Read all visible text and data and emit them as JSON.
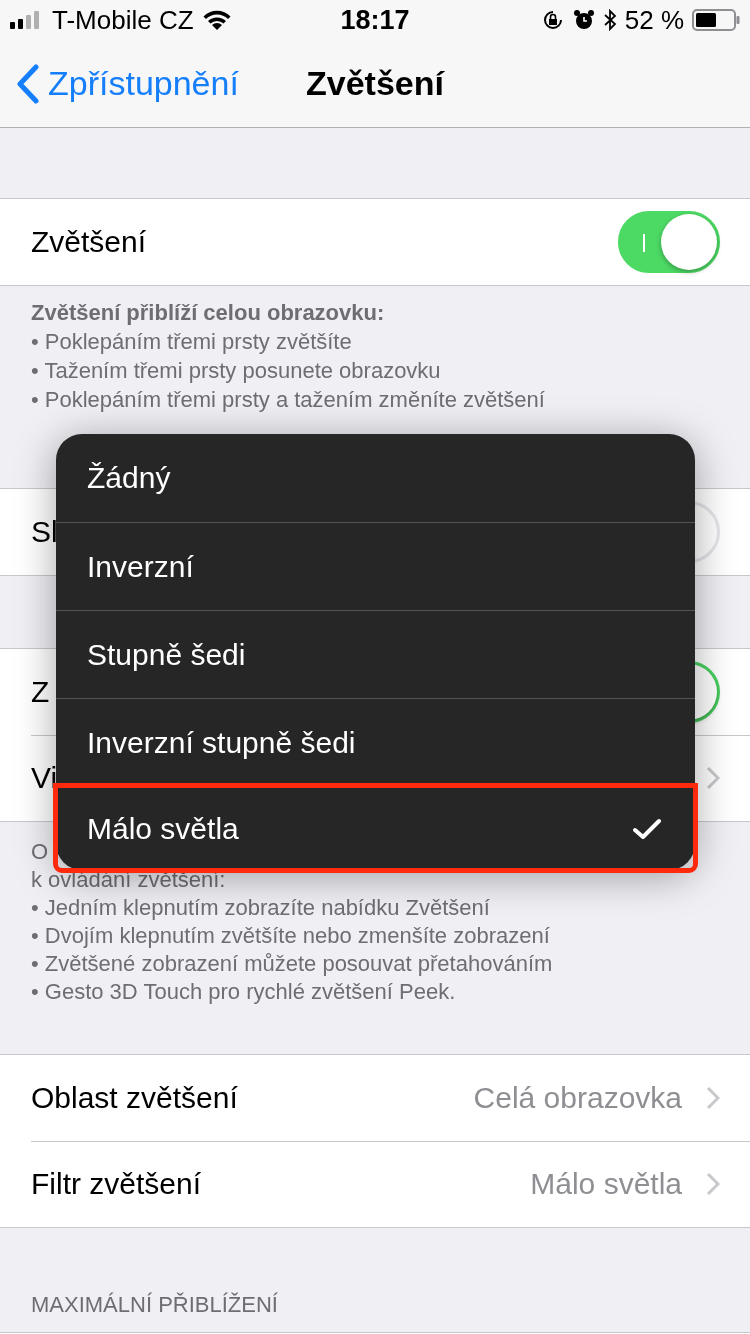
{
  "status_bar": {
    "carrier": "T-Mobile CZ",
    "time": "18:17",
    "battery": "52 %"
  },
  "nav": {
    "back": "Zpřístupnění",
    "title": "Zvětšení"
  },
  "section_1": {
    "row": {
      "label": "Zvětšení",
      "on": true
    },
    "footer": {
      "title": "Zvětšení přiblíží celou obrazovku:",
      "lines": [
        "• Poklepáním třemi prsty zvětšíte",
        "• Tažením třemi prsty posunete obrazovku",
        "• Poklepáním třemi prsty a tažením změníte zvětšení"
      ]
    }
  },
  "section_2": {
    "row": {
      "label": "Sl",
      "on": false
    }
  },
  "section_3": {
    "rows": [
      {
        "label": "Z",
        "kind": "toggle",
        "on": true
      },
      {
        "label": "Vi",
        "kind": "link"
      }
    ],
    "footer": {
      "lines": [
        "O",
        "k ovládání zvětšení:",
        "• Jedním klepnutím zobrazíte nabídku Zvětšení",
        "• Dvojím klepnutím zvětšíte nebo zmenšíte zobrazení",
        "• Zvětšené zobrazení můžete posouvat přetahováním",
        "• Gesto 3D Touch pro rychlé zvětšení Peek."
      ]
    }
  },
  "section_4": {
    "rows": [
      {
        "label": "Oblast zvětšení",
        "value": "Celá obrazovka"
      },
      {
        "label": "Filtr zvětšení",
        "value": "Málo světla"
      }
    ]
  },
  "section_5": {
    "header": "MAXIMÁLNÍ PŘIBLÍŽENÍ"
  },
  "filter_menu": {
    "items": [
      {
        "label": "Žádný",
        "selected": false,
        "highlighted": false
      },
      {
        "label": "Inverzní",
        "selected": false,
        "highlighted": false
      },
      {
        "label": "Stupně šedi",
        "selected": false,
        "highlighted": false
      },
      {
        "label": "Inverzní stupně šedi",
        "selected": false,
        "highlighted": false
      },
      {
        "label": "Málo světla",
        "selected": true,
        "highlighted": true
      }
    ]
  }
}
